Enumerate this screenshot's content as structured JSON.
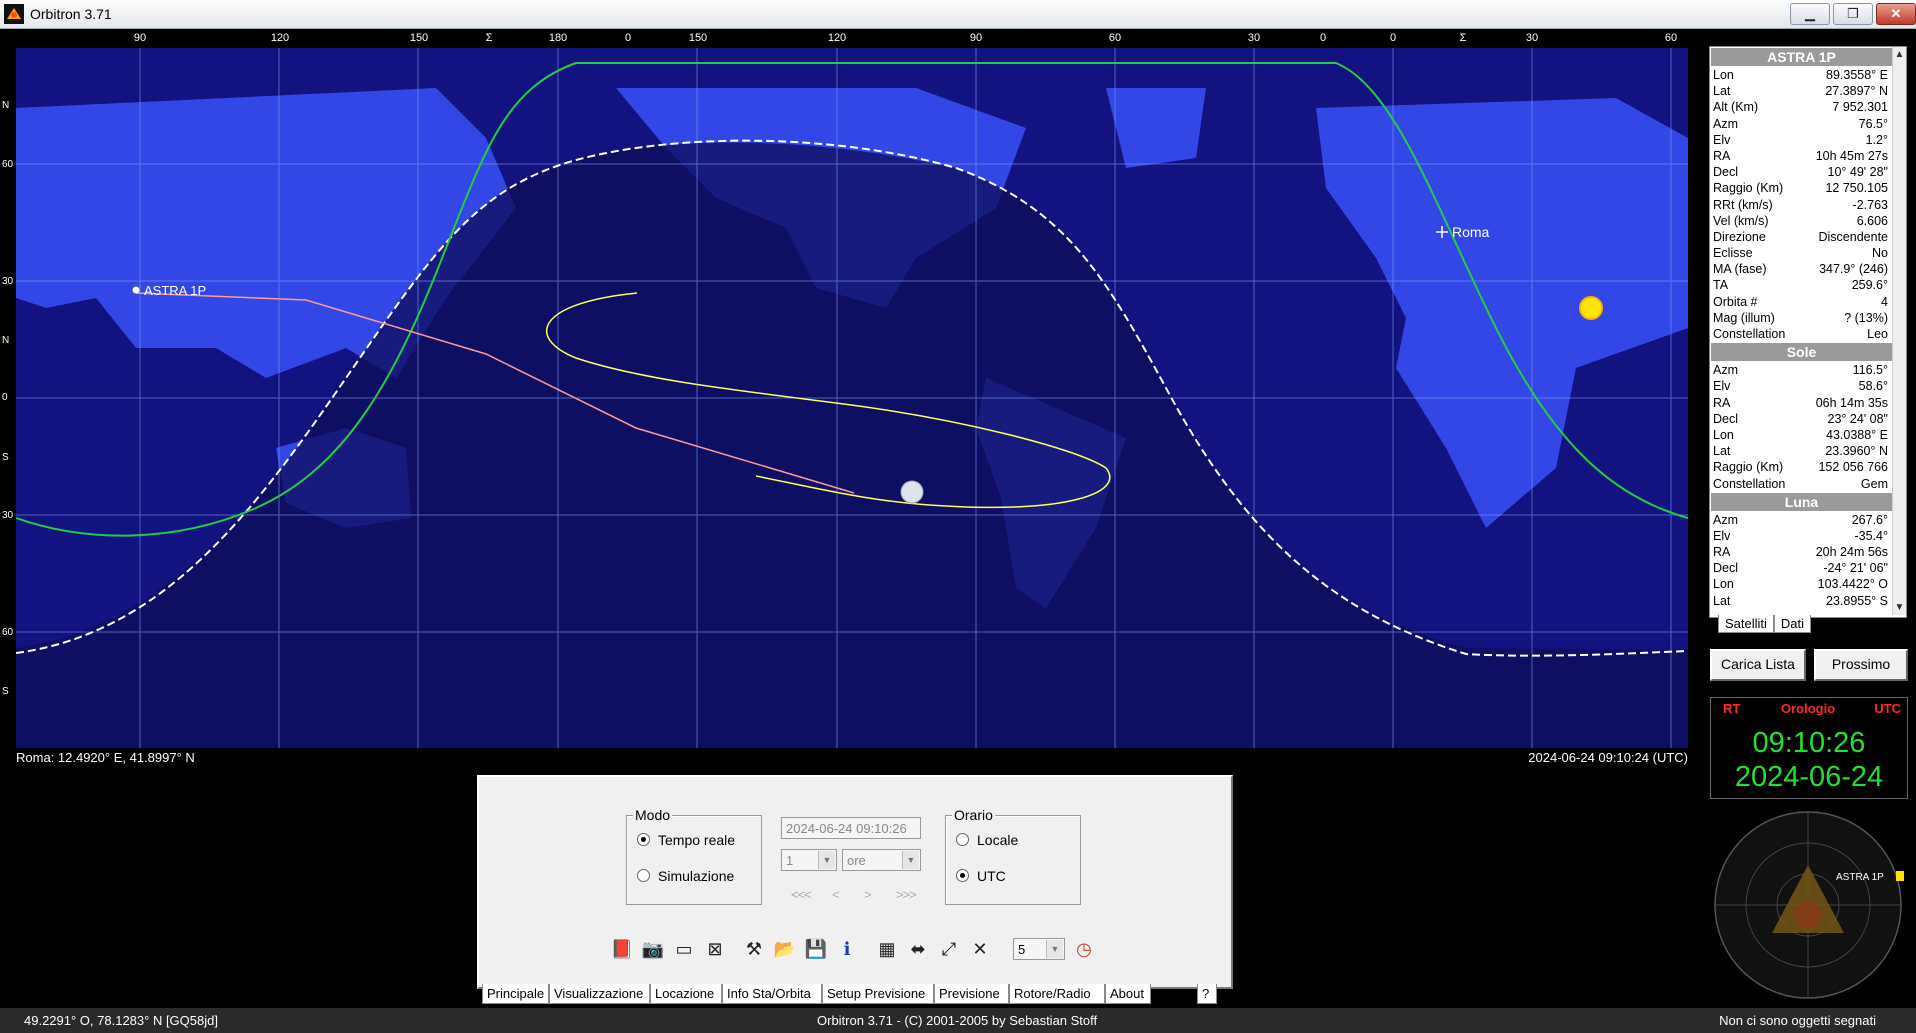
{
  "window": {
    "title": "Orbitron 3.71",
    "controls": {
      "minimize": "▁",
      "restore": "❐",
      "close": "✕"
    }
  },
  "map": {
    "top_ticks": [
      "90",
      "120",
      "150",
      "Σ",
      "180",
      "0",
      "150",
      "120",
      "90",
      "60",
      "30",
      "0",
      "0",
      "Σ",
      "30",
      "60"
    ],
    "lat_ticks": [
      "N",
      "60",
      "30",
      "N",
      "0",
      "S",
      "30",
      "60",
      "S"
    ],
    "labels": {
      "satellite": "ASTRA 1P",
      "location": "Roma"
    },
    "footer_left": "Roma: 12.4920° E, 41.8997° N",
    "footer_right": "2024-06-24 09:10:24 (UTC)",
    "colors": {
      "ocean": "#121280",
      "land": "#3346e6",
      "night": "#0d0d5a",
      "satellite_track": "#ff9a9a",
      "sun_track": "#ffff66",
      "visibility": "#22cc44",
      "terminator": "#ffffff"
    }
  },
  "satellite_panel": {
    "title": "ASTRA 1P",
    "rows": [
      {
        "k": "Lon",
        "v": "89.3558° E"
      },
      {
        "k": "Lat",
        "v": "27.3897° N"
      },
      {
        "k": "Alt (Km)",
        "v": "7 952.301"
      },
      {
        "k": "Azm",
        "v": "76.5°"
      },
      {
        "k": "Elv",
        "v": "1.2°"
      },
      {
        "k": "RA",
        "v": "10h 45m 27s"
      },
      {
        "k": "Decl",
        "v": "10° 49' 28\""
      },
      {
        "k": "Raggio (Km)",
        "v": "12 750.105"
      },
      {
        "k": "RRt (km/s)",
        "v": "-2.763"
      },
      {
        "k": "Vel (km/s)",
        "v": "6.606"
      },
      {
        "k": "Direzione",
        "v": "Discendente"
      },
      {
        "k": "Eclisse",
        "v": "No"
      },
      {
        "k": "MA (fase)",
        "v": "347.9° (246)"
      },
      {
        "k": "TA",
        "v": "259.6°"
      },
      {
        "k": "Orbita #",
        "v": "4"
      },
      {
        "k": "Mag (illum)",
        "v": "? (13%)"
      },
      {
        "k": "Constellation",
        "v": "Leo"
      }
    ],
    "sun_title": "Sole",
    "sun_rows": [
      {
        "k": "Azm",
        "v": "116.5°"
      },
      {
        "k": "Elv",
        "v": "58.6°"
      },
      {
        "k": "RA",
        "v": "06h 14m 35s"
      },
      {
        "k": "Decl",
        "v": "23° 24' 08\""
      },
      {
        "k": "Lon",
        "v": "43.0388° E"
      },
      {
        "k": "Lat",
        "v": "23.3960° N"
      },
      {
        "k": "Raggio (Km)",
        "v": "152 056 766"
      },
      {
        "k": "Constellation",
        "v": "Gem"
      }
    ],
    "moon_title": "Luna",
    "moon_rows": [
      {
        "k": "Azm",
        "v": "267.6°"
      },
      {
        "k": "Elv",
        "v": "-35.4°"
      },
      {
        "k": "RA",
        "v": "20h 24m 56s"
      },
      {
        "k": "Decl",
        "v": "-24° 21' 06\""
      },
      {
        "k": "Lon",
        "v": "103.4422° O"
      },
      {
        "k": "Lat",
        "v": "23.8955° S"
      }
    ],
    "tabs": [
      "Satelliti",
      "Dati"
    ]
  },
  "buttons": {
    "load_list": "Carica Lista",
    "next": "Prossimo"
  },
  "clock": {
    "rt": "RT",
    "title": "Orologio",
    "utc": "UTC",
    "time": "09:10:26",
    "date": "2024-06-24"
  },
  "radar": {
    "label": "ASTRA 1P"
  },
  "control": {
    "mode_legend": "Modo",
    "mode_realtime": "Tempo reale",
    "mode_simulation": "Simulazione",
    "datetime": "2024-06-24 09:10:26",
    "step_value": "1",
    "step_unit": "ore",
    "nav": [
      "<<<",
      "<",
      ">",
      ">>>"
    ],
    "time_legend": "Orario",
    "time_local": "Locale",
    "time_utc": "UTC",
    "speed_value": "5",
    "tabs": [
      "Principale",
      "Visualizzazione",
      "Locazione",
      "Info Sta/Orbita",
      "Setup Previsione",
      "Previsione",
      "Rotore/Radio",
      "About",
      "?"
    ]
  },
  "status_bar": {
    "left": "49.2291° O, 78.1283° N [GQ58jd]",
    "center": "Orbitron 3.71 - (C) 2001-2005 by Sebastian Stoff",
    "right": "Non ci sono oggetti segnati"
  }
}
